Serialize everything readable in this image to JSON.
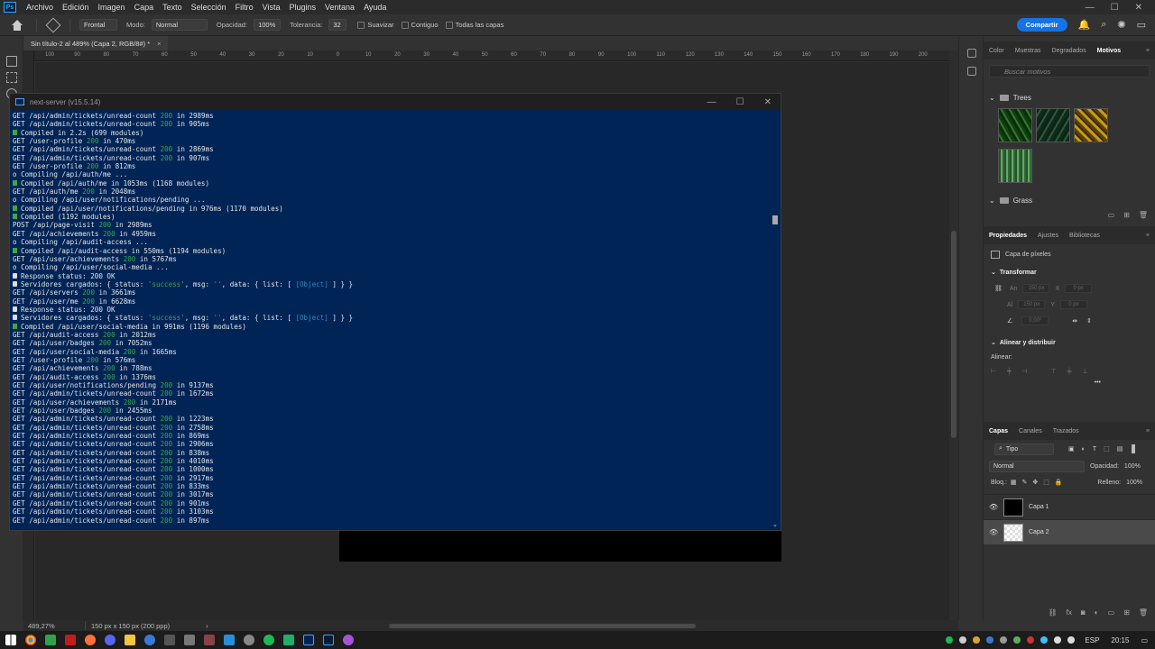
{
  "app": {
    "logo_text": "Ps",
    "menu": [
      "Archivo",
      "Edición",
      "Imagen",
      "Capa",
      "Texto",
      "Selección",
      "Filtro",
      "Vista",
      "Plugins",
      "Ventana",
      "Ayuda"
    ],
    "window_controls": {
      "minimize": "—",
      "maximize": "☐",
      "close": "✕"
    }
  },
  "options_bar": {
    "preset": "Frontal",
    "mode_label": "Modo:",
    "mode_value": "Normal",
    "opacity_label": "Opacidad:",
    "opacity_value": "100%",
    "tolerance_label": "Tolerancia:",
    "tolerance_value": "32",
    "smooth_label": "Suavizar",
    "contiguous_label": "Contiguo",
    "all_layers_label": "Todas las capas",
    "share_button": "Compartir"
  },
  "document": {
    "tab_title": "Sin título-2 al 489% (Capa 2, RGB/8#) *",
    "tab_close": "×",
    "ruler_h": [
      "100",
      "90",
      "80",
      "70",
      "60",
      "50",
      "40",
      "30",
      "20",
      "10",
      "0",
      "10",
      "20",
      "30",
      "40",
      "50",
      "60",
      "70",
      "80",
      "90",
      "100",
      "110",
      "120",
      "130",
      "140",
      "150",
      "160",
      "170",
      "180",
      "190",
      "200"
    ],
    "zoom": "489,27%",
    "doc_info": "150 px x 150 px (200 ppp)"
  },
  "terminal": {
    "title": "next-server (v15.5.14)",
    "lines": [
      {
        "t": "req",
        "m": "GET",
        "p": "/api/admin/tickets/unread-count",
        "s": "200",
        "d": "in 2989ms"
      },
      {
        "t": "req",
        "m": "GET",
        "p": "/api/admin/tickets/unread-count",
        "s": "200",
        "d": "in 905ms"
      },
      {
        "t": "ok",
        "x": "Compiled in 2.2s (699 modules)"
      },
      {
        "t": "req",
        "m": "GET",
        "p": "/user-profile",
        "s": "200",
        "d": "in 470ms"
      },
      {
        "t": "req",
        "m": "GET",
        "p": "/api/admin/tickets/unread-count",
        "s": "200",
        "d": "in 2869ms"
      },
      {
        "t": "req",
        "m": "GET",
        "p": "/api/admin/tickets/unread-count",
        "s": "200",
        "d": "in 907ms"
      },
      {
        "t": "req",
        "m": "GET",
        "p": "/user-profile",
        "s": "200",
        "d": "in 812ms"
      },
      {
        "t": "plain",
        "x": "o Compiling /api/auth/me ..."
      },
      {
        "t": "ok",
        "x": "Compiled /api/auth/me in 1053ms (1168 modules)"
      },
      {
        "t": "req",
        "m": "GET",
        "p": "/api/auth/me",
        "s": "200",
        "d": "in 2048ms"
      },
      {
        "t": "plain",
        "x": "o Compiling /api/user/notifications/pending ..."
      },
      {
        "t": "ok",
        "x": "Compiled /api/user/notifications/pending in 976ms (1170 modules)"
      },
      {
        "t": "ok",
        "x": "Compiled (1192 modules)"
      },
      {
        "t": "req",
        "m": "POST",
        "p": "/api/page-visit",
        "s": "200",
        "d": "in 2989ms"
      },
      {
        "t": "req",
        "m": "GET",
        "p": "/api/achievements",
        "s": "200",
        "d": "in 4959ms"
      },
      {
        "t": "plain",
        "x": "o Compiling /api/audit-access ..."
      },
      {
        "t": "ok",
        "x": "Compiled /api/audit-access in 550ms (1194 modules)"
      },
      {
        "t": "req",
        "m": "GET",
        "p": "/api/user/achievements",
        "s": "200",
        "d": "in 5767ms"
      },
      {
        "t": "plain",
        "x": "o Compiling /api/user/social-media ..."
      },
      {
        "t": "info",
        "x": "Response status: 200 OK"
      },
      {
        "t": "srv",
        "a": "Servidores cargados: { status: ",
        "b": "'success'",
        "c": ", msg: ",
        "d": "''",
        "e": ", data: { list: [ ",
        "f": "[Object]",
        "g": " ] } }"
      },
      {
        "t": "req",
        "m": "GET",
        "p": "/api/servers",
        "s": "200",
        "d": "in 3661ms"
      },
      {
        "t": "req",
        "m": "GET",
        "p": "/api/user/me",
        "s": "200",
        "d": "in 6628ms"
      },
      {
        "t": "info",
        "x": "Response status: 200 OK"
      },
      {
        "t": "srv",
        "a": "Servidores cargados: { status: ",
        "b": "'success'",
        "c": ", msg: ",
        "d": "''",
        "e": ", data: { list: [ ",
        "f": "[Object]",
        "g": " ] } }"
      },
      {
        "t": "ok",
        "x": "Compiled /api/user/social-media in 991ms (1196 modules)"
      },
      {
        "t": "req",
        "m": "GET",
        "p": "/api/audit-access",
        "s": "200",
        "d": "in 2012ms"
      },
      {
        "t": "req",
        "m": "GET",
        "p": "/api/user/badges",
        "s": "200",
        "d": "in 7052ms"
      },
      {
        "t": "req",
        "m": "GET",
        "p": "/api/user/social-media",
        "s": "200",
        "d": "in 1665ms"
      },
      {
        "t": "req",
        "m": "GET",
        "p": "/user-profile",
        "s": "200",
        "d": "in 576ms"
      },
      {
        "t": "req",
        "m": "GET",
        "p": "/api/achievements",
        "s": "200",
        "d": "in 788ms"
      },
      {
        "t": "req",
        "m": "GET",
        "p": "/api/audit-access",
        "s": "200",
        "d": "in 1376ms"
      },
      {
        "t": "req",
        "m": "GET",
        "p": "/api/user/notifications/pending",
        "s": "200",
        "d": "in 9137ms"
      },
      {
        "t": "req",
        "m": "GET",
        "p": "/api/admin/tickets/unread-count",
        "s": "200",
        "d": "in 1672ms"
      },
      {
        "t": "req",
        "m": "GET",
        "p": "/api/user/achievements",
        "s": "200",
        "d": "in 2171ms"
      },
      {
        "t": "req",
        "m": "GET",
        "p": "/api/user/badges",
        "s": "200",
        "d": "in 2455ms"
      },
      {
        "t": "req",
        "m": "GET",
        "p": "/api/admin/tickets/unread-count",
        "s": "200",
        "d": "in 1223ms"
      },
      {
        "t": "req",
        "m": "GET",
        "p": "/api/admin/tickets/unread-count",
        "s": "200",
        "d": "in 2758ms"
      },
      {
        "t": "req",
        "m": "GET",
        "p": "/api/admin/tickets/unread-count",
        "s": "200",
        "d": "in 869ms"
      },
      {
        "t": "req",
        "m": "GET",
        "p": "/api/admin/tickets/unread-count",
        "s": "200",
        "d": "in 2906ms"
      },
      {
        "t": "req",
        "m": "GET",
        "p": "/api/admin/tickets/unread-count",
        "s": "200",
        "d": "in 838ms"
      },
      {
        "t": "req",
        "m": "GET",
        "p": "/api/admin/tickets/unread-count",
        "s": "200",
        "d": "in 4010ms"
      },
      {
        "t": "req",
        "m": "GET",
        "p": "/api/admin/tickets/unread-count",
        "s": "200",
        "d": "in 1000ms"
      },
      {
        "t": "req",
        "m": "GET",
        "p": "/api/admin/tickets/unread-count",
        "s": "200",
        "d": "in 2917ms"
      },
      {
        "t": "req",
        "m": "GET",
        "p": "/api/admin/tickets/unread-count",
        "s": "200",
        "d": "in 833ms"
      },
      {
        "t": "req",
        "m": "GET",
        "p": "/api/admin/tickets/unread-count",
        "s": "200",
        "d": "in 3017ms"
      },
      {
        "t": "req",
        "m": "GET",
        "p": "/api/admin/tickets/unread-count",
        "s": "200",
        "d": "in 901ms"
      },
      {
        "t": "req",
        "m": "GET",
        "p": "/api/admin/tickets/unread-count",
        "s": "200",
        "d": "in 3103ms"
      },
      {
        "t": "req",
        "m": "GET",
        "p": "/api/admin/tickets/unread-count",
        "s": "200",
        "d": "in 897ms"
      }
    ]
  },
  "panels": {
    "top_tabs": [
      "Color",
      "Muestras",
      "Degradados",
      "Motivos"
    ],
    "active_top_tab": "Motivos",
    "search_placeholder": "Buscar motivos",
    "folder_trees": "Trees",
    "folder_grass": "Grass",
    "props_tabs": [
      "Propiedades",
      "Ajustes",
      "Bibliotecas"
    ],
    "active_props_tab": "Propiedades",
    "pixel_layer": "Capa de píxeles",
    "transform_header": "Transformar",
    "field_w_label": "An",
    "field_w": "150 px",
    "field_x_label": "X",
    "field_x": "0 px",
    "field_h_label": "Al",
    "field_h": "150 px",
    "field_y_label": "Y",
    "field_y": "0 px",
    "field_angle": "0,00°",
    "align_header": "Alinear y distribuir",
    "align_label": "Alinear:",
    "more": "•••",
    "layers_tabs": [
      "Capas",
      "Canales",
      "Trazados"
    ],
    "active_layers_tab": "Capas",
    "filter_kind": "Tipo",
    "blend_mode": "Normal",
    "opacity_label": "Opacidad:",
    "opacity_value": "100%",
    "lock_label": "Bloq.:",
    "fill_label": "Relleno:",
    "fill_value": "100%",
    "layers": [
      {
        "name": "Capa 1",
        "visible": true,
        "selected": false,
        "thumb": "black"
      },
      {
        "name": "Capa 2",
        "visible": true,
        "selected": true,
        "thumb": "transparent"
      }
    ]
  },
  "taskbar": {
    "language": "ESP",
    "time": "20:15"
  },
  "colors": {
    "accent": "#1473e6",
    "terminal_bg": "#012456",
    "status_green": "#3aa84a"
  }
}
